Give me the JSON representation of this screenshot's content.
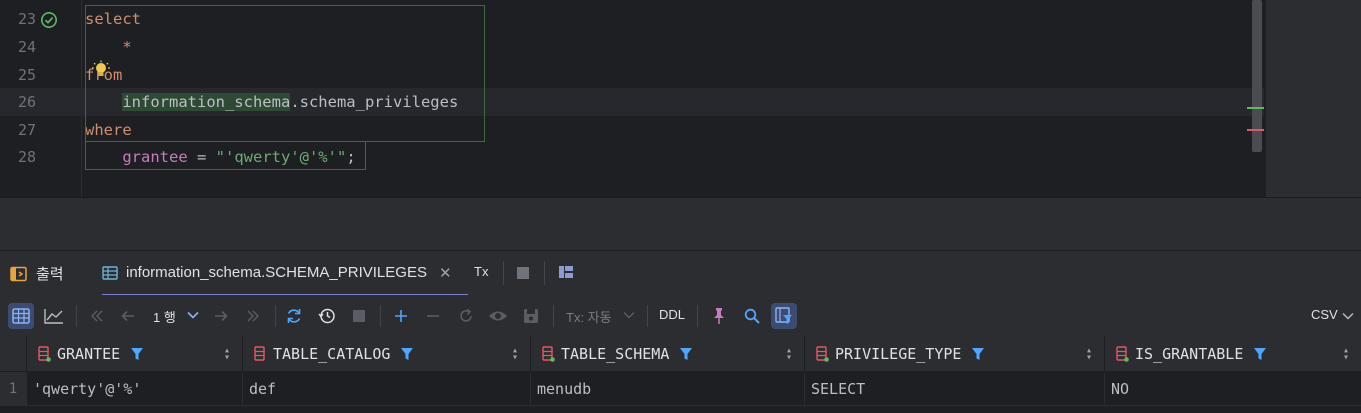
{
  "editor": {
    "lines": [
      {
        "num": "23",
        "tokens": [
          {
            "t": "select",
            "c": "kw"
          }
        ]
      },
      {
        "num": "24",
        "tokens": [
          {
            "t": "    *",
            "c": "kw"
          }
        ]
      },
      {
        "num": "25",
        "tokens": [
          {
            "t": "from",
            "c": "kw"
          }
        ]
      },
      {
        "num": "26",
        "tokens": [
          {
            "t": "    ",
            "c": "punc"
          },
          {
            "t": "information_schema",
            "c": "ident"
          },
          {
            "t": ".schema_privileges",
            "c": "ident"
          }
        ]
      },
      {
        "num": "27",
        "tokens": [
          {
            "t": "where",
            "c": "kw"
          }
        ]
      },
      {
        "num": "28",
        "tokens": [
          {
            "t": "    ",
            "c": "punc"
          },
          {
            "t": "grantee",
            "c": "fld"
          },
          {
            "t": " = ",
            "c": "op"
          },
          {
            "t": "\"'qwerty'@'%'\"",
            "c": "strv"
          },
          {
            "t": ";",
            "c": "punc"
          }
        ]
      }
    ]
  },
  "panel": {
    "tab_output": "출력",
    "tab_result": "information_schema.SCHEMA_PRIVILEGES",
    "tab_close": "✕",
    "tx": "Tx"
  },
  "toolbar": {
    "rows": "1 행",
    "tx_mode": "Tx: 자동",
    "ddl": "DDL",
    "export": "CSV"
  },
  "grid": {
    "columns": [
      "GRANTEE",
      "TABLE_CATALOG",
      "TABLE_SCHEMA",
      "PRIVILEGE_TYPE",
      "IS_GRANTABLE"
    ],
    "rows": [
      {
        "num": "1",
        "cells": [
          "'qwerty'@'%'",
          "def",
          "menudb",
          "SELECT",
          "NO"
        ]
      }
    ]
  },
  "colors": {
    "accent": "#7a7fd0",
    "keyword": "#cf8e6d",
    "string": "#6aab73",
    "field": "#c77dbb",
    "filter_icon": "#4fa6ff"
  }
}
